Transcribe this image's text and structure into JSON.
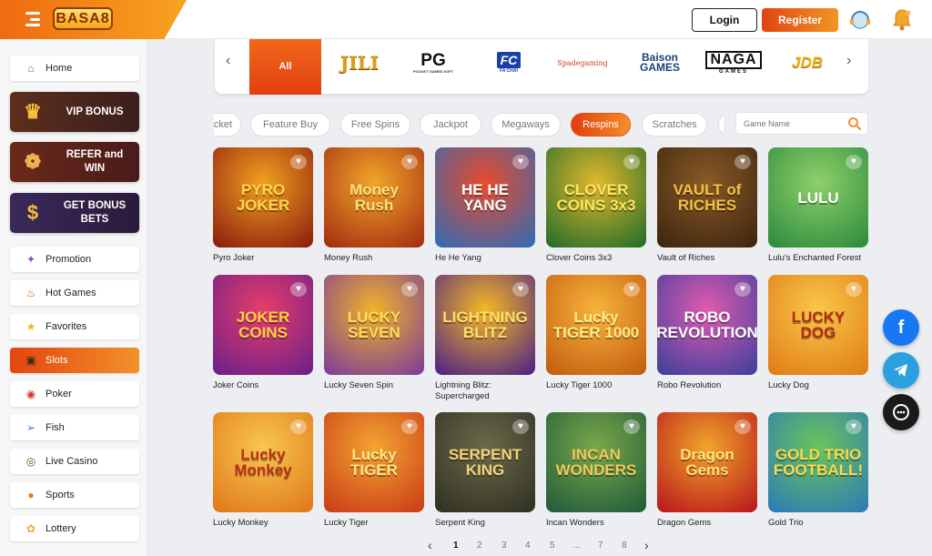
{
  "header": {
    "logo_text": "BASA8",
    "login_label": "Login",
    "register_label": "Register"
  },
  "sidebar": {
    "items": [
      {
        "label": "Home",
        "icon": "home-icon"
      },
      {
        "label": "Promotion",
        "icon": "promotion-icon"
      },
      {
        "label": "Hot Games",
        "icon": "fire-icon"
      },
      {
        "label": "Favorites",
        "icon": "star-icon"
      },
      {
        "label": "Slots",
        "icon": "slot-machine-icon"
      },
      {
        "label": "Poker",
        "icon": "poker-chip-icon"
      },
      {
        "label": "Fish",
        "icon": "fish-icon"
      },
      {
        "label": "Live Casino",
        "icon": "roulette-icon"
      },
      {
        "label": "Sports",
        "icon": "sports-ball-icon"
      },
      {
        "label": "Lottery",
        "icon": "lottery-icon"
      }
    ],
    "bonus_cards": [
      {
        "label": "VIP BONUS",
        "icon": "crown-icon"
      },
      {
        "label": "REFER and WIN",
        "icon": "gift-icon"
      },
      {
        "label": "GET BONUS BETS",
        "icon": "money-bag-icon"
      }
    ],
    "active_item": "Slots"
  },
  "providers": {
    "all_label": "All",
    "items": [
      {
        "label": "JILI",
        "color": "#d8a017"
      },
      {
        "label": "PG",
        "sub": "POCKET GAMES SOFT",
        "color": "#111111"
      },
      {
        "label": "FC",
        "sub": "FA CHAI",
        "color": "#1a3fa8"
      },
      {
        "label": "Spadegaming",
        "color": "#d2392b"
      },
      {
        "label": "Baison GAMES",
        "color": "#1d3f7a"
      },
      {
        "label": "NAGA",
        "sub": "GAMES",
        "color": "#111111"
      },
      {
        "label": "JDB",
        "color": "#e8b41c"
      }
    ]
  },
  "tags": {
    "items": [
      "cket",
      "Feature Buy",
      "Free Spins",
      "Jackpot",
      "Megaways",
      "Respins",
      "Scratches"
    ],
    "active": "Respins"
  },
  "search": {
    "placeholder": "Game Name"
  },
  "games": [
    {
      "name": "Pyro Joker",
      "art": "PYRO JOKER",
      "bg": "#8a1a0c",
      "bg2": "#f2a021",
      "fg": "#ffd84a"
    },
    {
      "name": "Money Rush",
      "art": "Money Rush",
      "bg": "#a32a0f",
      "bg2": "#f0a52b",
      "fg": "#ffe079"
    },
    {
      "name": "He He Yang",
      "art": "HE HE YANG",
      "bg": "#2d6bb8",
      "bg2": "#e84b2a",
      "fg": "#ffffff"
    },
    {
      "name": "Clover Coins 3x3",
      "art": "CLOVER COINS 3x3",
      "bg": "#1f6b2a",
      "bg2": "#e0b82c",
      "fg": "#ffe55c"
    },
    {
      "name": "Vault of Riches",
      "art": "VAULT of RICHES",
      "bg": "#3a2410",
      "bg2": "#8a5a24",
      "fg": "#f2c048"
    },
    {
      "name": "Lulu's Enchanted Forest",
      "art": "LULU",
      "bg": "#2a8a3c",
      "bg2": "#8fd06a",
      "fg": "#ffffff"
    },
    {
      "name": "Joker Coins",
      "art": "JOKER COINS",
      "bg": "#6a1f8a",
      "bg2": "#e63d6a",
      "fg": "#ffd13a"
    },
    {
      "name": "Lucky Seven Spin",
      "art": "LUCKY SEVEN",
      "bg": "#7a3a9a",
      "bg2": "#f0b22a",
      "fg": "#ffdd55"
    },
    {
      "name": "Lightning Blitz: Supercharged",
      "art": "LIGHTNING BLITZ",
      "bg": "#4a1e86",
      "bg2": "#f5b824",
      "fg": "#ffe066"
    },
    {
      "name": "Lucky Tiger 1000",
      "art": "Lucky TIGER 1000",
      "bg": "#c25a10",
      "bg2": "#f7b43a",
      "fg": "#ffeb8a"
    },
    {
      "name": "Robo Revolution",
      "art": "ROBO REVOLUTION",
      "bg": "#3a3f9a",
      "bg2": "#e05ab0",
      "fg": "#ffffff"
    },
    {
      "name": "Lucky Dog",
      "art": "LUCKY DOG",
      "bg": "#e07a14",
      "bg2": "#f8c84a",
      "fg": "#b52a12"
    },
    {
      "name": "Lucky Monkey",
      "art": "Lucky Monkey",
      "bg": "#e0761a",
      "bg2": "#f8c74e",
      "fg": "#b8301a"
    },
    {
      "name": "Lucky Tiger",
      "art": "Lucky TIGER",
      "bg": "#c93a16",
      "bg2": "#f3a432",
      "fg": "#ffe58a"
    },
    {
      "name": "Serpent King",
      "art": "SERPENT KING",
      "bg": "#2f2f22",
      "bg2": "#6b6a4a",
      "fg": "#f4d27a"
    },
    {
      "name": "Incan Wonders",
      "art": "INCAN WONDERS",
      "bg": "#1f5a3a",
      "bg2": "#7aa84a",
      "fg": "#f2c85a"
    },
    {
      "name": "Dragon Gems",
      "art": "Dragon Gems",
      "bg": "#b8141a",
      "bg2": "#f0a52a",
      "fg": "#ffe27a"
    },
    {
      "name": "Gold Trio",
      "art": "GOLD TRIO FOOTBALL!",
      "bg": "#2a7ab8",
      "bg2": "#6bc45a",
      "fg": "#ffd84a"
    }
  ],
  "pagination": {
    "pages": [
      "1",
      "2",
      "3",
      "4",
      "5",
      "...",
      "7",
      "8"
    ],
    "current": "1"
  },
  "social": [
    {
      "name": "facebook-icon",
      "glyph": "f",
      "color": "#1877f2"
    },
    {
      "name": "telegram-icon",
      "glyph": "➤",
      "color": "#2aa1de"
    },
    {
      "name": "live-chat-icon",
      "glyph": "☺",
      "color": "#1a1a1a"
    }
  ]
}
